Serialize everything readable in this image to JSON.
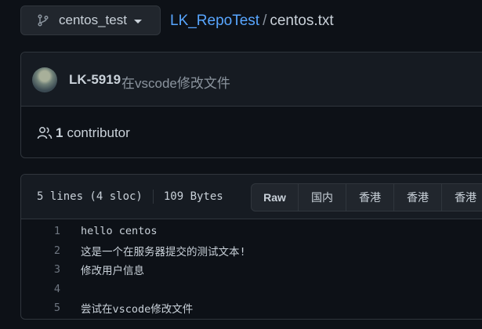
{
  "header": {
    "branch_name": "centos_test",
    "repo_name": "LK_RepoTest",
    "separator": "/",
    "file_name": "centos.txt"
  },
  "commit": {
    "author": "LK-5919",
    "message": "在vscode修改文件",
    "contributors_count": "1",
    "contributors_label": "contributor"
  },
  "file": {
    "lines_info": "5 lines (4 sloc)",
    "size": "109 Bytes",
    "buttons": {
      "raw": "Raw",
      "mirror_1": "国内",
      "mirror_2": "香港",
      "mirror_3": "香港",
      "mirror_4": "香港"
    },
    "lines": [
      {
        "number": "1",
        "text": "hello centos"
      },
      {
        "number": "2",
        "text": "这是一个在服务器提交的测试文本!"
      },
      {
        "number": "3",
        "text": "修改用户信息"
      },
      {
        "number": "4",
        "text": ""
      },
      {
        "number": "5",
        "text": "尝试在vscode修改文件"
      }
    ]
  },
  "colors": {
    "background": "#0d1117",
    "panel": "#161b22",
    "border": "#30363d",
    "link": "#58a6ff",
    "text": "#c9d1d9",
    "muted": "#8b949e"
  },
  "icons": {
    "branch": "git-branch-icon",
    "caret": "caret-down-icon",
    "people": "people-icon"
  }
}
